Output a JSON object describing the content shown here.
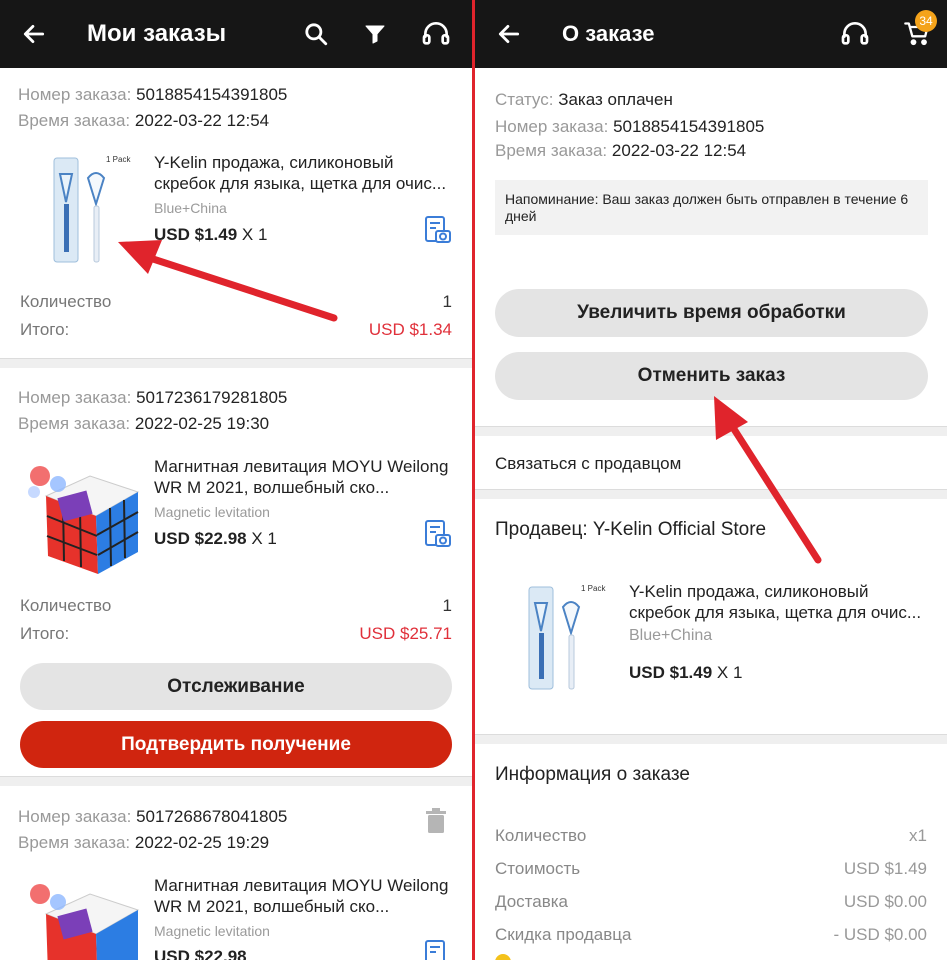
{
  "left": {
    "title": "Мои заказы",
    "orders": [
      {
        "number_label": "Номер заказа:",
        "number": "5018854154391805",
        "time_label": "Время заказа:",
        "time": "2022-03-22 12:54",
        "pack_label": "1 Pack",
        "title": "Y-Kelin продажа, силиконовый скребок для языка, щетка для очис...",
        "variant": "Blue+China",
        "price": "USD $1.49",
        "qty_mult": "X 1",
        "qty_label": "Количество",
        "qty": "1",
        "total_label": "Итого:",
        "total": "USD $1.34"
      },
      {
        "number_label": "Номер заказа:",
        "number": "5017236179281805",
        "time_label": "Время заказа:",
        "time": "2022-02-25 19:30",
        "title": "Магнитная левитация MOYU Weilong WR M 2021, волшебный ско...",
        "variant": "Magnetic levitation",
        "price": "USD $22.98",
        "qty_mult": "X 1",
        "qty_label": "Количество",
        "qty": "1",
        "total_label": "Итого:",
        "total": "USD $25.71",
        "track_label": "Отслеживание",
        "confirm_label": "Подтвердить получение"
      },
      {
        "number_label": "Номер заказа:",
        "number": "5017268678041805",
        "time_label": "Время заказа:",
        "time": "2022-02-25 19:29",
        "title": "Магнитная левитация MOYU Weilong WR M 2021, волшебный ско...",
        "variant": "Magnetic levitation",
        "price": "USD $22.98"
      }
    ]
  },
  "right": {
    "title": "О заказе",
    "cart_badge": "34",
    "status_label": "Статус:",
    "status": "Заказ оплачен",
    "number_label": "Номер заказа:",
    "number": "5018854154391805",
    "time_label": "Время заказа:",
    "time": "2022-03-22 12:54",
    "notice": "Напоминание: Ваш заказ должен быть отправлен в течение 6 дней",
    "extend_label": "Увеличить время обработки",
    "cancel_label": "Отменить заказ",
    "contact_label": "Связаться с продавцом",
    "seller_label": "Продавец: Y-Kelin Official Store",
    "product": {
      "pack_label": "1 Pack",
      "title": "Y-Kelin продажа, силиконовый скребок для языка, щетка для очис...",
      "variant": "Blue+China",
      "price": "USD $1.49",
      "qty_mult": "X 1"
    },
    "info_title": "Информация о заказе",
    "info_rows": [
      {
        "label": "Количество",
        "value": "x1"
      },
      {
        "label": "Стоимость",
        "value": "USD $1.49"
      },
      {
        "label": "Доставка",
        "value": "USD $0.00"
      },
      {
        "label": "Скидка продавца",
        "value": "- USD $0.00"
      }
    ]
  },
  "colors": {
    "topbar": "#161616",
    "accent_red": "#d0250f",
    "price_red": "#e0303a",
    "badge": "#f4a31b",
    "annotation_arrow": "#e0242c"
  }
}
